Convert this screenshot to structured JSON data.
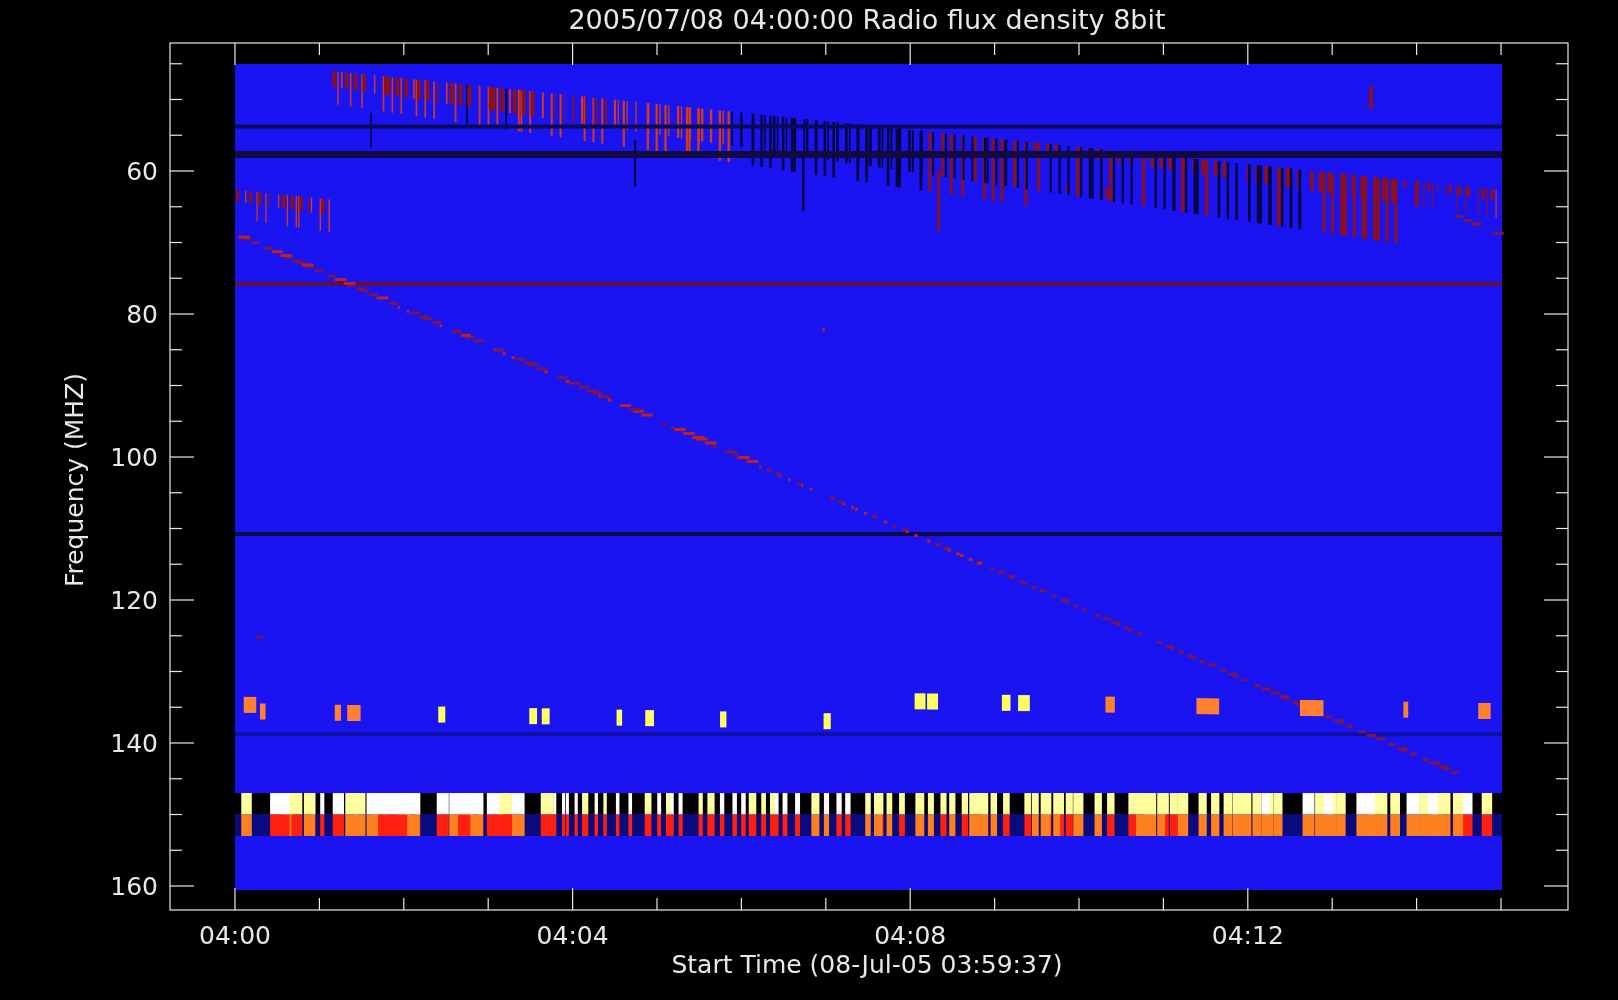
{
  "plot": {
    "title": "2005/07/08 04:00:00 Radio flux density 8bit",
    "xlabel": "Start Time (08-Jul-05 03:59:37)",
    "ylabel": "Frequency (MHZ)",
    "x_tick_labels": [
      "04:00",
      "04:04",
      "04:08",
      "04:12"
    ],
    "y_tick_labels": [
      "60",
      "80",
      "100",
      "120",
      "140",
      "160"
    ]
  }
}
